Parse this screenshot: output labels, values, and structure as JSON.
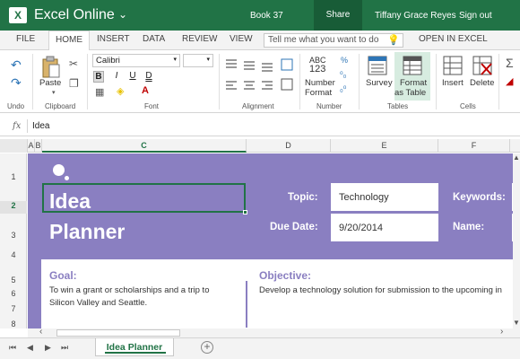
{
  "app": {
    "name": "Excel Online",
    "book": "Book 37",
    "share": "Share",
    "user": "Tiffany Grace Reyes",
    "signout": "Sign out"
  },
  "ribbon_tabs": [
    "FILE",
    "HOME",
    "INSERT",
    "DATA",
    "REVIEW",
    "VIEW"
  ],
  "active_tab": "HOME",
  "tellme_placeholder": "Tell me what you want to do",
  "open_in_excel": "OPEN IN EXCEL",
  "ribbon": {
    "undo_label": "Undo",
    "clipboard": {
      "label": "Clipboard",
      "paste": "Paste"
    },
    "font": {
      "label": "Font",
      "name": "Calibri",
      "size": "",
      "bold": "B",
      "italic": "I",
      "underline": "U",
      "dunderline": "D"
    },
    "alignment": {
      "label": "Alignment"
    },
    "number": {
      "label": "Number",
      "format1": "Number",
      "format2": "Format",
      "abc": "ABC",
      "num": "123"
    },
    "tables": {
      "label": "Tables",
      "survey": "Survey",
      "format1": "Format",
      "format2": "as Table"
    },
    "cells": {
      "label": "Cells",
      "insert": "Insert",
      "delete": "Delete"
    }
  },
  "formula_bar": {
    "fx": "fx",
    "value": "Idea"
  },
  "columns": [
    "A",
    "B",
    "C",
    "D",
    "E",
    "F"
  ],
  "rows": [
    "1",
    "2",
    "3",
    "4",
    "5",
    "6",
    "7",
    "8"
  ],
  "selected_column": "C",
  "selected_row": "2",
  "sheet": {
    "title_line1": "Idea",
    "title_line2": "Planner",
    "topic_label": "Topic:",
    "topic_value": "Technology",
    "keywords_label": "Keywords:",
    "due_label": "Due Date:",
    "due_value": "9/20/2014",
    "name_label": "Name:",
    "goal_heading": "Goal:",
    "goal_text_1": "To win a grant or scholarships and a trip to",
    "goal_text_2": "Silicon Valley and Seattle.",
    "objective_heading": "Objective:",
    "objective_text": "Develop a technology solution for submission to the upcoming in"
  },
  "sheet_tab": "Idea Planner",
  "colors": {
    "brand": "#217346",
    "banner": "#8a7fc1"
  }
}
